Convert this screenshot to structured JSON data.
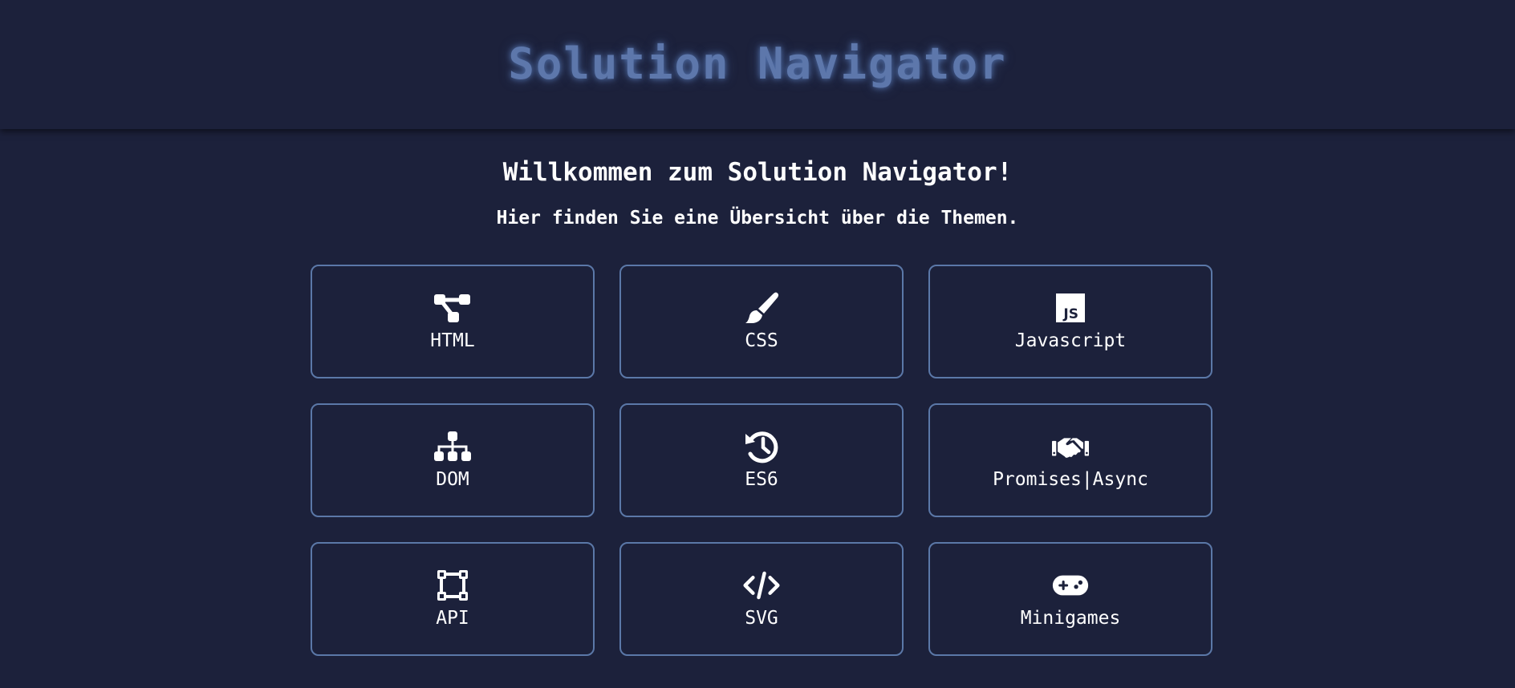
{
  "header": {
    "title": "Solution Navigator"
  },
  "main": {
    "welcome": "Willkommen zum Solution Navigator!",
    "subtitle": "Hier finden Sie eine Übersicht über die Themen.",
    "topics": [
      {
        "label": "HTML",
        "icon": "sitemap-icon"
      },
      {
        "label": "CSS",
        "icon": "paintbrush-icon"
      },
      {
        "label": "Javascript",
        "icon": "js-icon"
      },
      {
        "label": "DOM",
        "icon": "hierarchy-icon"
      },
      {
        "label": "ES6",
        "icon": "history-icon"
      },
      {
        "label": "Promises|Async",
        "icon": "handshake-icon"
      },
      {
        "label": "API",
        "icon": "vector-square-icon"
      },
      {
        "label": "SVG",
        "icon": "code-icon"
      },
      {
        "label": "Minigames",
        "icon": "gamepad-icon"
      }
    ]
  },
  "colors": {
    "background": "#1c213b",
    "title": "#5d77ab",
    "card_border": "#5b78a8",
    "text": "#ffffff"
  }
}
